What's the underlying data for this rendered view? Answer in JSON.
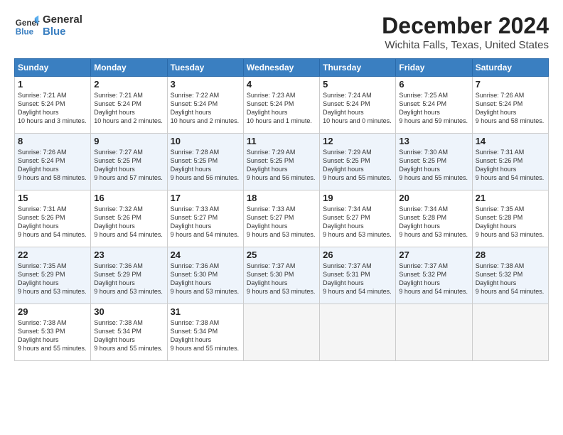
{
  "header": {
    "logo_line1": "General",
    "logo_line2": "Blue",
    "month": "December 2024",
    "location": "Wichita Falls, Texas, United States"
  },
  "days_of_week": [
    "Sunday",
    "Monday",
    "Tuesday",
    "Wednesday",
    "Thursday",
    "Friday",
    "Saturday"
  ],
  "weeks": [
    [
      {
        "num": "1",
        "rise": "7:21 AM",
        "set": "5:24 PM",
        "daylight": "10 hours and 3 minutes."
      },
      {
        "num": "2",
        "rise": "7:21 AM",
        "set": "5:24 PM",
        "daylight": "10 hours and 2 minutes."
      },
      {
        "num": "3",
        "rise": "7:22 AM",
        "set": "5:24 PM",
        "daylight": "10 hours and 2 minutes."
      },
      {
        "num": "4",
        "rise": "7:23 AM",
        "set": "5:24 PM",
        "daylight": "10 hours and 1 minute."
      },
      {
        "num": "5",
        "rise": "7:24 AM",
        "set": "5:24 PM",
        "daylight": "10 hours and 0 minutes."
      },
      {
        "num": "6",
        "rise": "7:25 AM",
        "set": "5:24 PM",
        "daylight": "9 hours and 59 minutes."
      },
      {
        "num": "7",
        "rise": "7:26 AM",
        "set": "5:24 PM",
        "daylight": "9 hours and 58 minutes."
      }
    ],
    [
      {
        "num": "8",
        "rise": "7:26 AM",
        "set": "5:24 PM",
        "daylight": "9 hours and 58 minutes."
      },
      {
        "num": "9",
        "rise": "7:27 AM",
        "set": "5:25 PM",
        "daylight": "9 hours and 57 minutes."
      },
      {
        "num": "10",
        "rise": "7:28 AM",
        "set": "5:25 PM",
        "daylight": "9 hours and 56 minutes."
      },
      {
        "num": "11",
        "rise": "7:29 AM",
        "set": "5:25 PM",
        "daylight": "9 hours and 56 minutes."
      },
      {
        "num": "12",
        "rise": "7:29 AM",
        "set": "5:25 PM",
        "daylight": "9 hours and 55 minutes."
      },
      {
        "num": "13",
        "rise": "7:30 AM",
        "set": "5:25 PM",
        "daylight": "9 hours and 55 minutes."
      },
      {
        "num": "14",
        "rise": "7:31 AM",
        "set": "5:26 PM",
        "daylight": "9 hours and 54 minutes."
      }
    ],
    [
      {
        "num": "15",
        "rise": "7:31 AM",
        "set": "5:26 PM",
        "daylight": "9 hours and 54 minutes."
      },
      {
        "num": "16",
        "rise": "7:32 AM",
        "set": "5:26 PM",
        "daylight": "9 hours and 54 minutes."
      },
      {
        "num": "17",
        "rise": "7:33 AM",
        "set": "5:27 PM",
        "daylight": "9 hours and 54 minutes."
      },
      {
        "num": "18",
        "rise": "7:33 AM",
        "set": "5:27 PM",
        "daylight": "9 hours and 53 minutes."
      },
      {
        "num": "19",
        "rise": "7:34 AM",
        "set": "5:27 PM",
        "daylight": "9 hours and 53 minutes."
      },
      {
        "num": "20",
        "rise": "7:34 AM",
        "set": "5:28 PM",
        "daylight": "9 hours and 53 minutes."
      },
      {
        "num": "21",
        "rise": "7:35 AM",
        "set": "5:28 PM",
        "daylight": "9 hours and 53 minutes."
      }
    ],
    [
      {
        "num": "22",
        "rise": "7:35 AM",
        "set": "5:29 PM",
        "daylight": "9 hours and 53 minutes."
      },
      {
        "num": "23",
        "rise": "7:36 AM",
        "set": "5:29 PM",
        "daylight": "9 hours and 53 minutes."
      },
      {
        "num": "24",
        "rise": "7:36 AM",
        "set": "5:30 PM",
        "daylight": "9 hours and 53 minutes."
      },
      {
        "num": "25",
        "rise": "7:37 AM",
        "set": "5:30 PM",
        "daylight": "9 hours and 53 minutes."
      },
      {
        "num": "26",
        "rise": "7:37 AM",
        "set": "5:31 PM",
        "daylight": "9 hours and 54 minutes."
      },
      {
        "num": "27",
        "rise": "7:37 AM",
        "set": "5:32 PM",
        "daylight": "9 hours and 54 minutes."
      },
      {
        "num": "28",
        "rise": "7:38 AM",
        "set": "5:32 PM",
        "daylight": "9 hours and 54 minutes."
      }
    ],
    [
      {
        "num": "29",
        "rise": "7:38 AM",
        "set": "5:33 PM",
        "daylight": "9 hours and 55 minutes."
      },
      {
        "num": "30",
        "rise": "7:38 AM",
        "set": "5:34 PM",
        "daylight": "9 hours and 55 minutes."
      },
      {
        "num": "31",
        "rise": "7:38 AM",
        "set": "5:34 PM",
        "daylight": "9 hours and 55 minutes."
      },
      null,
      null,
      null,
      null
    ]
  ]
}
